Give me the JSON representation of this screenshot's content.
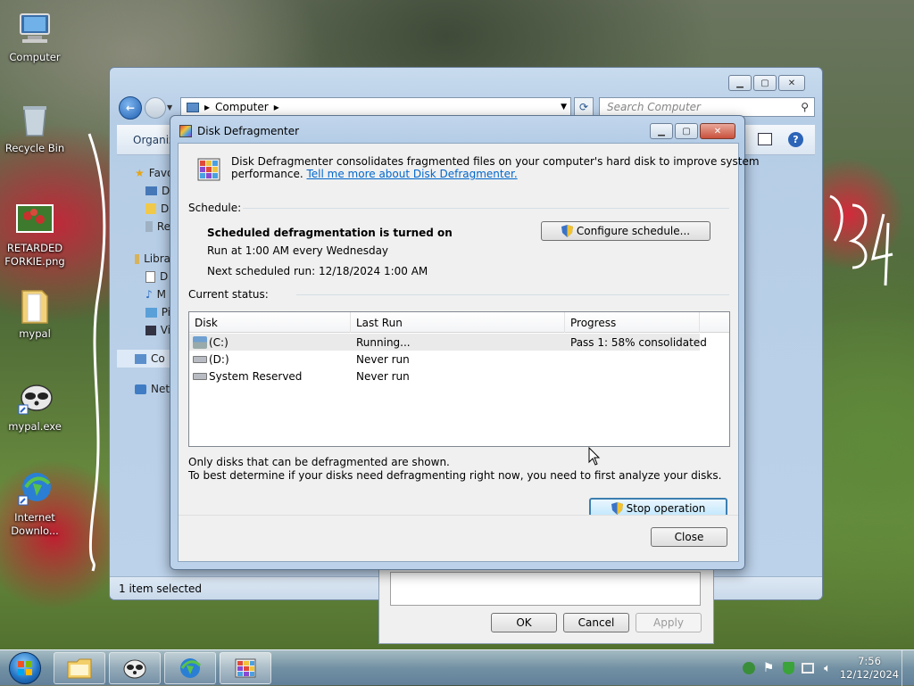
{
  "desktop": {
    "icons": [
      {
        "label": "Computer",
        "icon": "computer-icon"
      },
      {
        "label": "Recycle Bin",
        "icon": "recycle-bin-icon"
      },
      {
        "label": "RETARDED FORKIE.png",
        "icon": "image-file-icon"
      },
      {
        "label": "mypal",
        "icon": "folder-icon"
      },
      {
        "label": "mypal.exe",
        "icon": "raccoon-app-icon"
      },
      {
        "label": "Internet Downlo...",
        "icon": "internet-download-manager-icon"
      }
    ]
  },
  "explorer": {
    "address_parts": [
      "Computer"
    ],
    "search_placeholder": "Search Computer",
    "toolbar_label": "Organiz",
    "nav_items": [
      "Favo",
      "D",
      "D",
      "Re",
      "Libra",
      "D",
      "M",
      "Pi",
      "Vi",
      "Co",
      "Net"
    ],
    "status_text": "1 item selected"
  },
  "properties_dialog": {
    "ok_label": "OK",
    "cancel_label": "Cancel",
    "apply_label": "Apply"
  },
  "defrag": {
    "title": "Disk Defragmenter",
    "intro_text": "Disk Defragmenter consolidates fragmented files on your computer's hard disk to improve system",
    "intro_text_2": "performance.",
    "intro_link": "Tell me more about Disk Defragmenter.",
    "schedule_label": "Schedule:",
    "schedule_status": "Scheduled defragmentation is turned on",
    "schedule_run_at": "Run at 1:00 AM every Wednesday",
    "schedule_next": "Next scheduled run: 12/18/2024 1:00 AM",
    "configure_button": "Configure schedule...",
    "current_status_label": "Current status:",
    "columns": [
      "Disk",
      "Last Run",
      "Progress"
    ],
    "disks": [
      {
        "disk": "(C:)",
        "last_run": "Running...",
        "progress": "Pass 1: 58% consolidated"
      },
      {
        "disk": "(D:)",
        "last_run": "Never run",
        "progress": ""
      },
      {
        "disk": "System Reserved",
        "last_run": "Never run",
        "progress": ""
      }
    ],
    "note_1": "Only disks that can be defragmented are shown.",
    "note_2": "To best determine if your disks need defragmenting right now, you need to first analyze your disks.",
    "stop_button": "Stop operation",
    "close_button": "Close"
  },
  "taskbar": {
    "items": [
      "windows-explorer-icon",
      "mypal-browser-icon",
      "internet-download-manager-icon",
      "disk-defragmenter-icon"
    ],
    "clock_time": "7:56",
    "clock_date": "12/12/2024"
  },
  "colors": {
    "link": "#0066cc",
    "title_bar": "#b4cce6",
    "close_button": "#c9513c"
  }
}
